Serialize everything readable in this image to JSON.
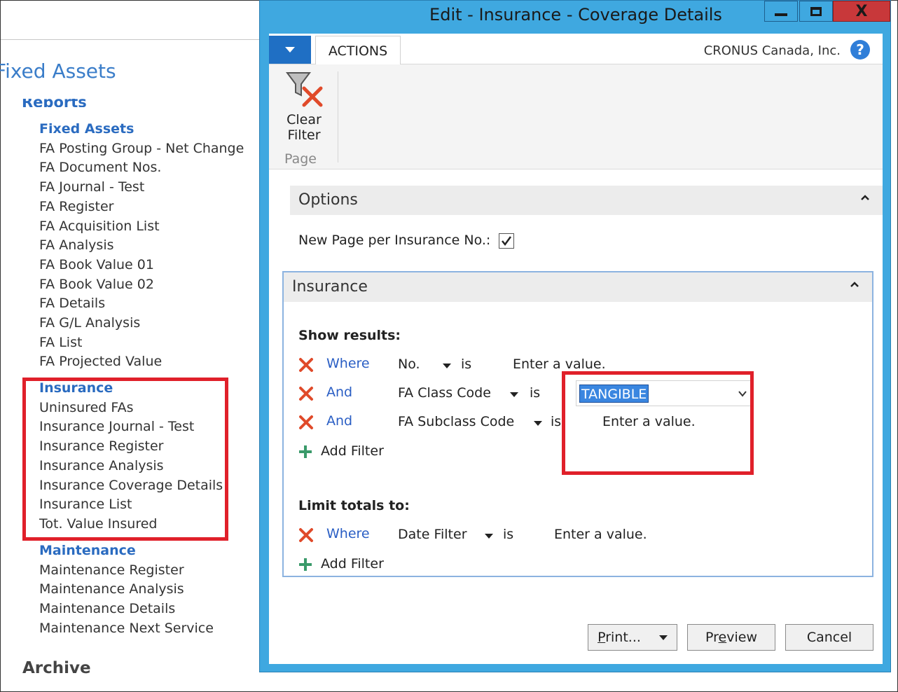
{
  "background_page": {
    "title": "Fixed Assets",
    "reports_heading": "Reports",
    "groups": [
      {
        "heading": "Fixed Assets",
        "items": [
          "FA Posting Group - Net Change",
          "FA Document Nos.",
          "FA Journal - Test",
          "FA Register",
          "FA Acquisition List",
          "FA Analysis",
          "FA Book Value 01",
          "FA Book Value 02",
          "FA Details",
          "FA G/L Analysis",
          "FA List",
          "FA Projected Value"
        ]
      },
      {
        "heading": "Insurance",
        "items": [
          "Uninsured FAs",
          "Insurance Journal - Test",
          "Insurance Register",
          "Insurance Analysis",
          "Insurance Coverage Details",
          "Insurance List",
          "Tot. Value Insured"
        ]
      },
      {
        "heading": "Maintenance",
        "items": [
          "Maintenance Register",
          "Maintenance Analysis",
          "Maintenance Details",
          "Maintenance Next Service"
        ]
      }
    ],
    "archive_heading": "Archive"
  },
  "dialog": {
    "title": "Edit - Insurance - Coverage Details",
    "close_glyph": "X",
    "tab_actions": "ACTIONS",
    "company": "CRONUS Canada, Inc.",
    "help_glyph": "?",
    "ribbon": {
      "clear_filter_line1": "Clear",
      "clear_filter_line2": "Filter",
      "group_label": "Page"
    },
    "options": {
      "title": "Options",
      "new_page_label": "New Page per Insurance No.:",
      "new_page_checked": true
    },
    "insurance": {
      "title": "Insurance",
      "show_results_label": "Show results:",
      "filters": [
        {
          "keyword": "Where",
          "field": "No.",
          "op": "is",
          "value": "Enter a value."
        },
        {
          "keyword": "And",
          "field": "FA Class Code",
          "op": "is",
          "value": "TANGIBLE"
        },
        {
          "keyword": "And",
          "field": "FA Subclass Code",
          "op": "is",
          "value": "Enter a value."
        }
      ],
      "add_filter": "Add Filter",
      "limit_totals_label": "Limit totals to:",
      "totals_filters": [
        {
          "keyword": "Where",
          "field": "Date Filter",
          "op": "is",
          "value": "Enter a value."
        }
      ],
      "add_filter_2": "Add Filter"
    },
    "buttons": {
      "print_u": "P",
      "print_rest": "rint...",
      "preview_pre": "Pr",
      "preview_u": "e",
      "preview_post": "view",
      "cancel": "Cancel"
    }
  },
  "colors": {
    "dialog_frame": "#3fa8e0",
    "link_blue": "#2a5ec4",
    "highlight_red": "#e0202a",
    "delete_x": "#e04a2a",
    "add_plus": "#3a9a6a",
    "selection": "#3a86e0"
  }
}
